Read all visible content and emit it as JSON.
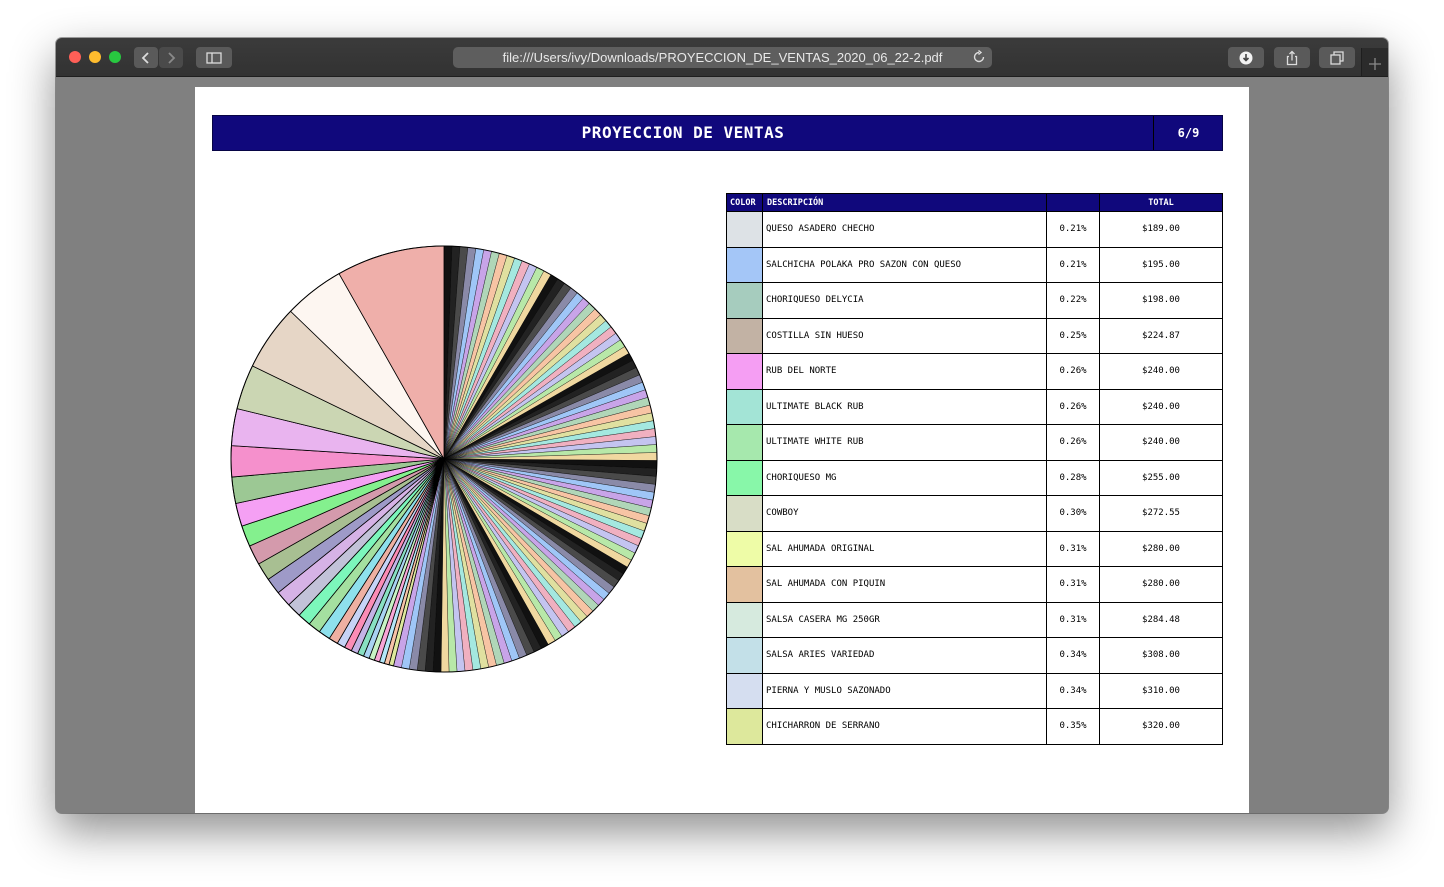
{
  "browser": {
    "url": "file:///Users/ivy/Downloads/PROYECCION_DE_VENTAS_2020_06_22-2.pdf"
  },
  "report": {
    "title": "PROYECCION DE VENTAS",
    "page": "6/9"
  },
  "legend_table": {
    "headers": {
      "color": "COLOR",
      "description": "DESCRIPCIÓN",
      "percent": "",
      "total": "TOTAL"
    },
    "rows": [
      {
        "color": "#dde2e6",
        "description": "QUESO ASADERO CHECHO",
        "percent": "0.21%",
        "total": "$189.00"
      },
      {
        "color": "#a4c6f7",
        "description": "SALCHICHA POLAKA PRO SAZON CON QUESO",
        "percent": "0.21%",
        "total": "$195.00"
      },
      {
        "color": "#a6ccbe",
        "description": "CHORIQUESO DELYCIA",
        "percent": "0.22%",
        "total": "$198.00"
      },
      {
        "color": "#c2b2a4",
        "description": "COSTILLA SIN HUESO",
        "percent": "0.25%",
        "total": "$224.87"
      },
      {
        "color": "#f59ef3",
        "description": "RUB DEL NORTE",
        "percent": "0.26%",
        "total": "$240.00"
      },
      {
        "color": "#a3e4d6",
        "description": "ULTIMATE BLACK RUB",
        "percent": "0.26%",
        "total": "$240.00"
      },
      {
        "color": "#a6e8ad",
        "description": "ULTIMATE WHITE RUB",
        "percent": "0.26%",
        "total": "$240.00"
      },
      {
        "color": "#88f7a9",
        "description": "CHORIQUESO MG",
        "percent": "0.28%",
        "total": "$255.00"
      },
      {
        "color": "#d8ddc6",
        "description": "COWBOY",
        "percent": "0.30%",
        "total": "$272.55"
      },
      {
        "color": "#eefca7",
        "description": "SAL AHUMADA ORIGINAL",
        "percent": "0.31%",
        "total": "$280.00"
      },
      {
        "color": "#e3c19f",
        "description": "SAL AHUMADA CON PIQUIN",
        "percent": "0.31%",
        "total": "$280.00"
      },
      {
        "color": "#d6eade",
        "description": "SALSA CASERA MG 250GR",
        "percent": "0.31%",
        "total": "$284.48"
      },
      {
        "color": "#c3e0e8",
        "description": "SALSA ARIES VARIEDAD",
        "percent": "0.34%",
        "total": "$308.00"
      },
      {
        "color": "#d5def0",
        "description": "PIERNA Y MUSLO SAZONADO",
        "percent": "0.34%",
        "total": "$310.00"
      },
      {
        "color": "#dde89c",
        "description": "CHICHARRON DE SERRANO",
        "percent": "0.35%",
        "total": "$320.00"
      }
    ]
  },
  "chart_data": {
    "type": "pie",
    "start": "top",
    "direction": "clockwise",
    "tail": {
      "note": "many thin unlabeled slices between the top and the first larger slices",
      "colors": [
        "#111111",
        "#222222",
        "#4a4a4a",
        "#8a8aa8",
        "#9fc6f7",
        "#c8a4e8",
        "#b0d6b8",
        "#f7c4a4",
        "#e0e0a0",
        "#a4e8e0",
        "#f0b0c0",
        "#c4c4f0",
        "#b8e8a8",
        "#f0d8a0"
      ]
    },
    "slices": [
      {
        "value": 0.35,
        "color": "#dde89c"
      },
      {
        "value": 0.36,
        "color": "#f6c3a8"
      },
      {
        "value": 0.38,
        "color": "#b3e6f7"
      },
      {
        "value": 0.4,
        "color": "#f7a6d6"
      },
      {
        "value": 0.42,
        "color": "#c7f2c4"
      },
      {
        "value": 0.45,
        "color": "#a9d3f2"
      },
      {
        "value": 0.48,
        "color": "#88e0c2"
      },
      {
        "value": 0.52,
        "color": "#c4b3e6"
      },
      {
        "value": 0.56,
        "color": "#fb8cb6"
      },
      {
        "value": 0.62,
        "color": "#c6d3f6"
      },
      {
        "value": 0.7,
        "color": "#eeb0a2"
      },
      {
        "value": 0.9,
        "color": "#8ee0ec"
      },
      {
        "value": 0.95,
        "color": "#a4e0a0"
      },
      {
        "value": 1.0,
        "color": "#7cf7bb"
      },
      {
        "value": 1.1,
        "color": "#c2c2d8"
      },
      {
        "value": 1.2,
        "color": "#d6b2e6"
      },
      {
        "value": 1.25,
        "color": "#9e9ac8"
      },
      {
        "value": 1.35,
        "color": "#a8bf92"
      },
      {
        "value": 1.5,
        "color": "#d49aac"
      },
      {
        "value": 1.6,
        "color": "#84f08e"
      },
      {
        "value": 1.75,
        "color": "#f5a0f4"
      },
      {
        "value": 2.0,
        "color": "#9cc894"
      },
      {
        "value": 2.35,
        "color": "#f590cc"
      },
      {
        "value": 2.8,
        "color": "#e9b4ef"
      },
      {
        "value": 3.4,
        "color": "#cbd6b3"
      },
      {
        "value": 5.0,
        "color": "#e6d6c6"
      },
      {
        "value": 4.6,
        "color": "#fdf6f1"
      },
      {
        "value": 8.2,
        "color": "#efafaa"
      }
    ]
  }
}
